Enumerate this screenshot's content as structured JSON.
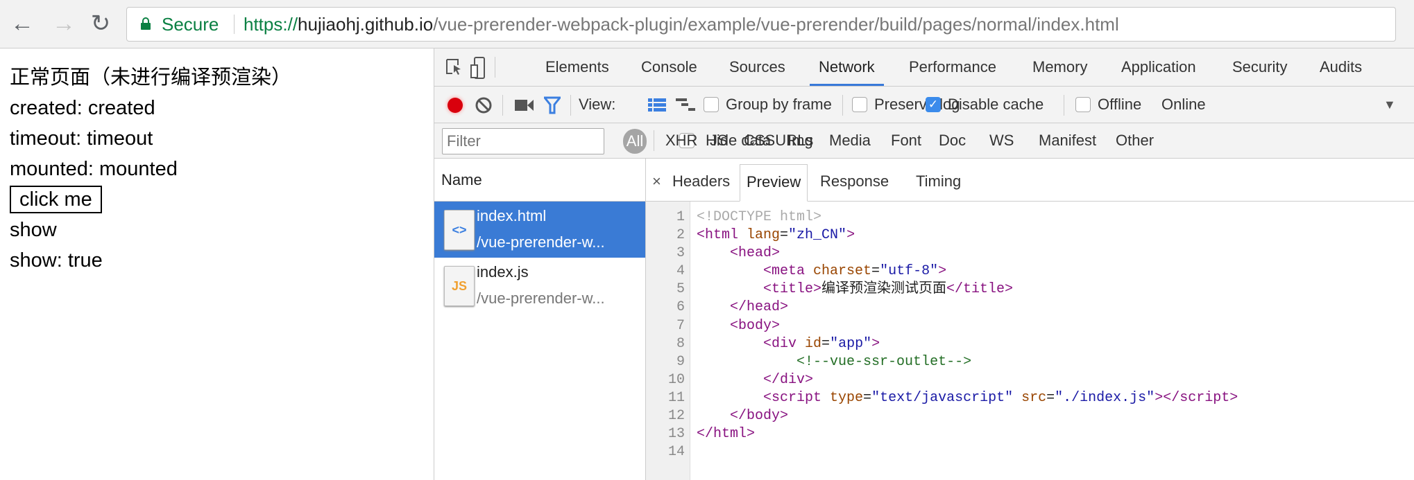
{
  "browser": {
    "secure_label": "Secure",
    "url_scheme": "https://",
    "url_host": "hujiaohj.github.io",
    "url_path": "/vue-prerender-webpack-plugin/example/vue-prerender/build/pages/normal/index.html"
  },
  "page": {
    "lines": [
      "正常页面（未进行编译预渲染）",
      "created: created",
      "timeout: timeout",
      "mounted: mounted"
    ],
    "button": "click me",
    "after": [
      "show",
      "show: true"
    ]
  },
  "devtools": {
    "tabs": [
      "Elements",
      "Console",
      "Sources",
      "Network",
      "Performance",
      "Memory",
      "Application",
      "Security",
      "Audits"
    ],
    "active_tab": "Network",
    "toolbar": {
      "view_label": "View:",
      "group_by_frame": "Group by frame",
      "preserve_log": "Preserve log",
      "disable_cache": "Disable cache",
      "offline": "Offline",
      "throttle": "Online"
    },
    "filter": {
      "placeholder": "Filter",
      "hide_data_urls": "Hide data URLs",
      "types": [
        "All",
        "XHR",
        "JS",
        "CSS",
        "Img",
        "Media",
        "Font",
        "Doc",
        "WS",
        "Manifest",
        "Other"
      ]
    },
    "requests": {
      "header": "Name",
      "items": [
        {
          "name": "index.html",
          "path": "/vue-prerender-w...",
          "icon": "<>"
        },
        {
          "name": "index.js",
          "path": "/vue-prerender-w...",
          "icon": "JS"
        }
      ]
    },
    "preview_tabs": [
      "Headers",
      "Preview",
      "Response",
      "Timing"
    ],
    "close": "×",
    "code": [
      [
        [
          "doc",
          "<!DOCTYPE html>"
        ]
      ],
      [
        [
          "tag",
          "<html "
        ],
        [
          "attr",
          "lang"
        ],
        [
          "txt",
          "="
        ],
        [
          "val",
          "\"zh_CN\""
        ],
        [
          "tag",
          ">"
        ]
      ],
      [
        [
          "txt",
          "    "
        ],
        [
          "tag",
          "<head>"
        ]
      ],
      [
        [
          "txt",
          "        "
        ],
        [
          "tag",
          "<meta "
        ],
        [
          "attr",
          "charset"
        ],
        [
          "txt",
          "="
        ],
        [
          "val",
          "\"utf-8\""
        ],
        [
          "tag",
          ">"
        ]
      ],
      [
        [
          "txt",
          "        "
        ],
        [
          "tag",
          "<title>"
        ],
        [
          "txt",
          "编译预渲染测试页面"
        ],
        [
          "tag",
          "</title>"
        ]
      ],
      [
        [
          "txt",
          "    "
        ],
        [
          "tag",
          "</head>"
        ]
      ],
      [
        [
          "txt",
          "    "
        ],
        [
          "tag",
          "<body>"
        ]
      ],
      [
        [
          "txt",
          "        "
        ],
        [
          "tag",
          "<div "
        ],
        [
          "attr",
          "id"
        ],
        [
          "txt",
          "="
        ],
        [
          "val",
          "\"app\""
        ],
        [
          "tag",
          ">"
        ]
      ],
      [
        [
          "txt",
          "            "
        ],
        [
          "cmt",
          "<!--vue-ssr-outlet-->"
        ]
      ],
      [
        [
          "txt",
          "        "
        ],
        [
          "tag",
          "</div>"
        ]
      ],
      [
        [
          "txt",
          "        "
        ],
        [
          "tag",
          "<script "
        ],
        [
          "attr",
          "type"
        ],
        [
          "txt",
          "="
        ],
        [
          "val",
          "\"text/javascript\""
        ],
        [
          "txt",
          " "
        ],
        [
          "attr",
          "src"
        ],
        [
          "txt",
          "="
        ],
        [
          "val",
          "\"./index.js\""
        ],
        [
          "tag",
          "></script>"
        ]
      ],
      [
        [
          "txt",
          "    "
        ],
        [
          "tag",
          "</body>"
        ]
      ],
      [
        [
          "tag",
          "</html>"
        ]
      ],
      []
    ]
  }
}
